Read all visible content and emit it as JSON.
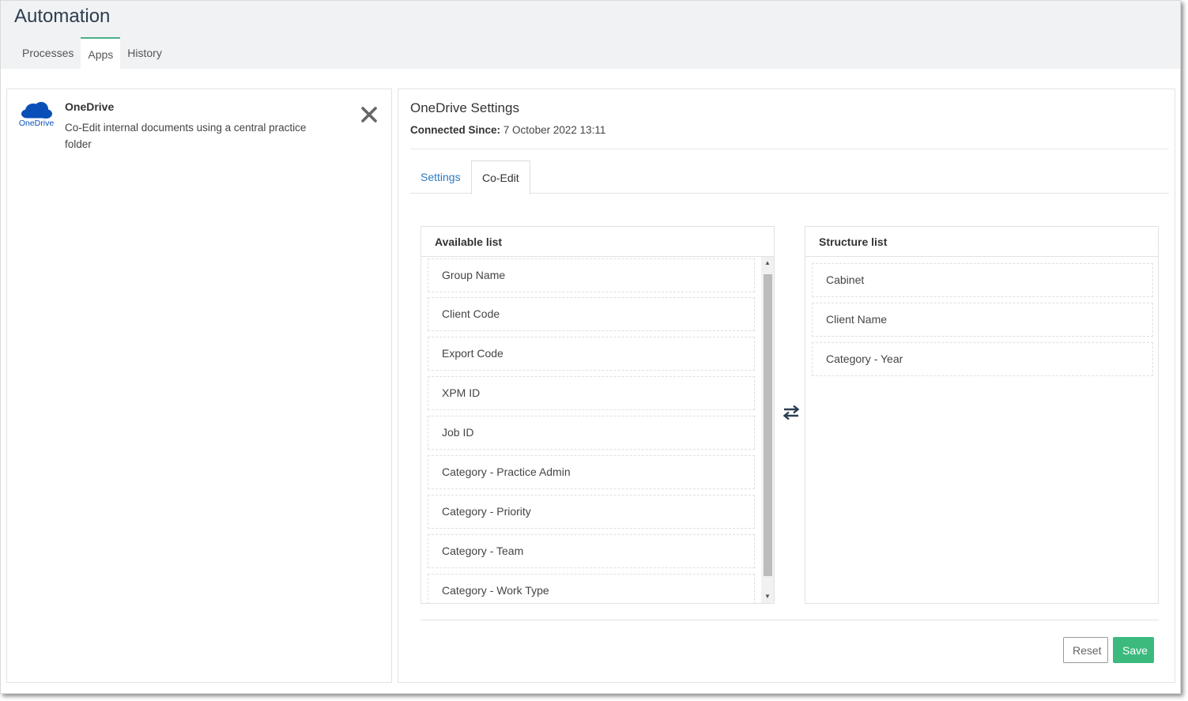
{
  "header": {
    "title": "Automation",
    "tabs": [
      {
        "label": "Processes",
        "active": false
      },
      {
        "label": "Apps",
        "active": true
      },
      {
        "label": "History",
        "active": false
      }
    ]
  },
  "app_card": {
    "logo_icon": "onedrive-cloud-icon",
    "logo_text": "OneDrive",
    "name": "OneDrive",
    "description": "Co-Edit internal documents using a central practice folder",
    "close_icon": "close-x-icon"
  },
  "settings": {
    "title": "OneDrive Settings",
    "connected_label": "Connected Since:",
    "connected_value": "7 October 2022 13:11",
    "tabs": [
      {
        "label": "Settings",
        "active": false
      },
      {
        "label": "Co-Edit",
        "active": true
      }
    ],
    "available_list": {
      "header": "Available list",
      "items": [
        "Group Name",
        "Client Code",
        "Export Code",
        "XPM ID",
        "Job ID",
        "Category - Practice Admin",
        "Category - Priority",
        "Category - Team",
        "Category - Work Type"
      ]
    },
    "structure_list": {
      "header": "Structure list",
      "items": [
        "Cabinet",
        "Client Name",
        "Category - Year"
      ]
    },
    "swap_icon": "swap-arrows-icon",
    "buttons": {
      "reset": "Reset",
      "save": "Save"
    }
  },
  "colors": {
    "accent": "#3cba7e",
    "link": "#2a7ac0",
    "title": "#2c3e50",
    "brand_onedrive": "#0a4fb8"
  }
}
